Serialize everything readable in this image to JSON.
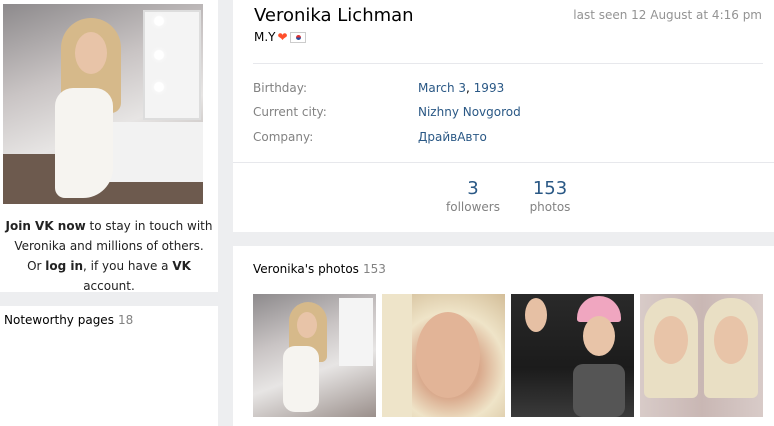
{
  "sidebar": {
    "join_link": "Join VK now",
    "join_line1_rest": " to stay in touch with",
    "join_line2": "Veronika and millions of others.",
    "or_text": "Or ",
    "login_link": "log in",
    "line3_mid": ", if you have a ",
    "vk_brand": "VK",
    "line3_end": " account.",
    "noteworthy_label": "Noteworthy pages",
    "noteworthy_count": "18"
  },
  "profile": {
    "name": "Veronika Lichman",
    "last_seen": "last seen 12 August at 4:16 pm",
    "status_text": "M.Y",
    "status_heart": "❤",
    "info": [
      {
        "label": "Birthday:",
        "value_a": "March 3",
        "sep": ", ",
        "value_b": "1993"
      },
      {
        "label": "Current city:",
        "value_a": "Nizhny Novgorod"
      },
      {
        "label": "Company:",
        "value_a": "ДрайвАвто"
      }
    ],
    "counters": [
      {
        "number": "3",
        "label": "followers"
      },
      {
        "number": "153",
        "label": "photos"
      }
    ]
  },
  "photos": {
    "title": "Veronika's photos",
    "count": "153"
  }
}
